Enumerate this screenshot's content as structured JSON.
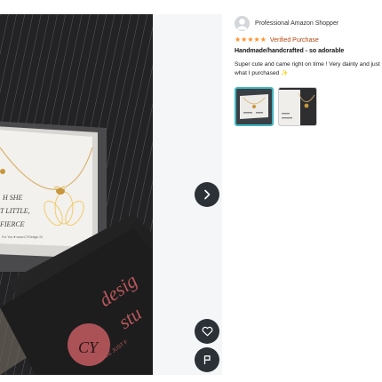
{
  "reviewer": {
    "name": "Professional Amazon Shopper",
    "avatar_icon": "user-silhouette-icon"
  },
  "review": {
    "rating": 5,
    "rating_max": 5,
    "verified_label": "Verified Purchase",
    "headline": "Handmade/handcrafted - so adorable",
    "body": "Super cute and came right on time ! Very dainty and just what I purchased",
    "body_emoji": "sparkles-icon",
    "thumbnails": [
      {
        "label": "review-image-1",
        "selected": true
      },
      {
        "label": "review-image-2",
        "selected": false
      }
    ]
  },
  "viewer": {
    "next_icon": "chevron-right-icon",
    "like_icon": "heart-icon",
    "report_icon": "flag-icon"
  },
  "photo_text": {
    "card_line1": "H SHE",
    "card_line2": "T LITTLE,",
    "card_line3": "FIERCE",
    "card_footer": "For You  ♥  www.CYDesign.St",
    "box_brand_1": "desig",
    "box_brand_2": "stu",
    "box_monogram": "CY",
    "box_tagline": "MADE JUST F"
  },
  "colors": {
    "star": "#ff8f26",
    "verified": "#b1470d",
    "thumb_selected_border": "#3fb6c1",
    "viewer_button": "#2b3137"
  }
}
